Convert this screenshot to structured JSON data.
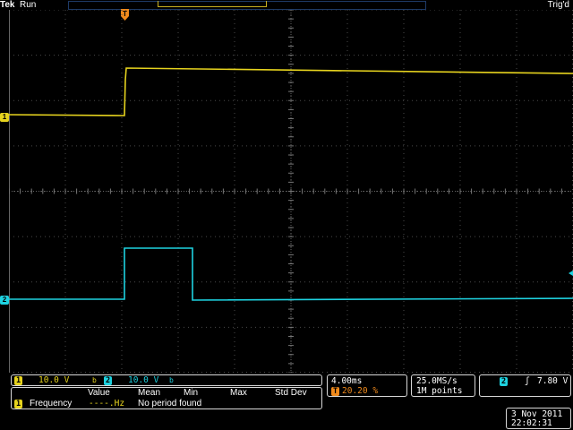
{
  "header": {
    "brand": "Tek",
    "run_state": "Run",
    "trigger_state": "Trig'd"
  },
  "channels": {
    "ch1": {
      "label": "1",
      "color": "#e6d31e"
    },
    "ch2": {
      "label": "2",
      "color": "#1ed2e0"
    }
  },
  "markers": {
    "trigger": "T"
  },
  "readout": {
    "ch1_scale": "10.0 V",
    "ch2_scale": "10.0 V",
    "ch1_badge": "1",
    "ch2_badge": "2",
    "bw_symbol": "b",
    "timebase": "4.00ms",
    "trigger_position": "20.20 %",
    "trigger_badge": "T",
    "sample_rate": "25.0MS/s",
    "record_length": "1M points",
    "trigger_source_badge": "2",
    "trigger_slope_symbol": "ʃ",
    "trigger_level": "7.80 V"
  },
  "measurements": {
    "headers": [
      "Value",
      "Mean",
      "Min",
      "Max",
      "Std Dev"
    ],
    "rows": [
      {
        "channel": "1",
        "name": "Frequency",
        "value": "----.Hz",
        "status": "No period found"
      }
    ]
  },
  "datetime": {
    "date": "3 Nov 2011",
    "time": "22:02:31"
  }
}
